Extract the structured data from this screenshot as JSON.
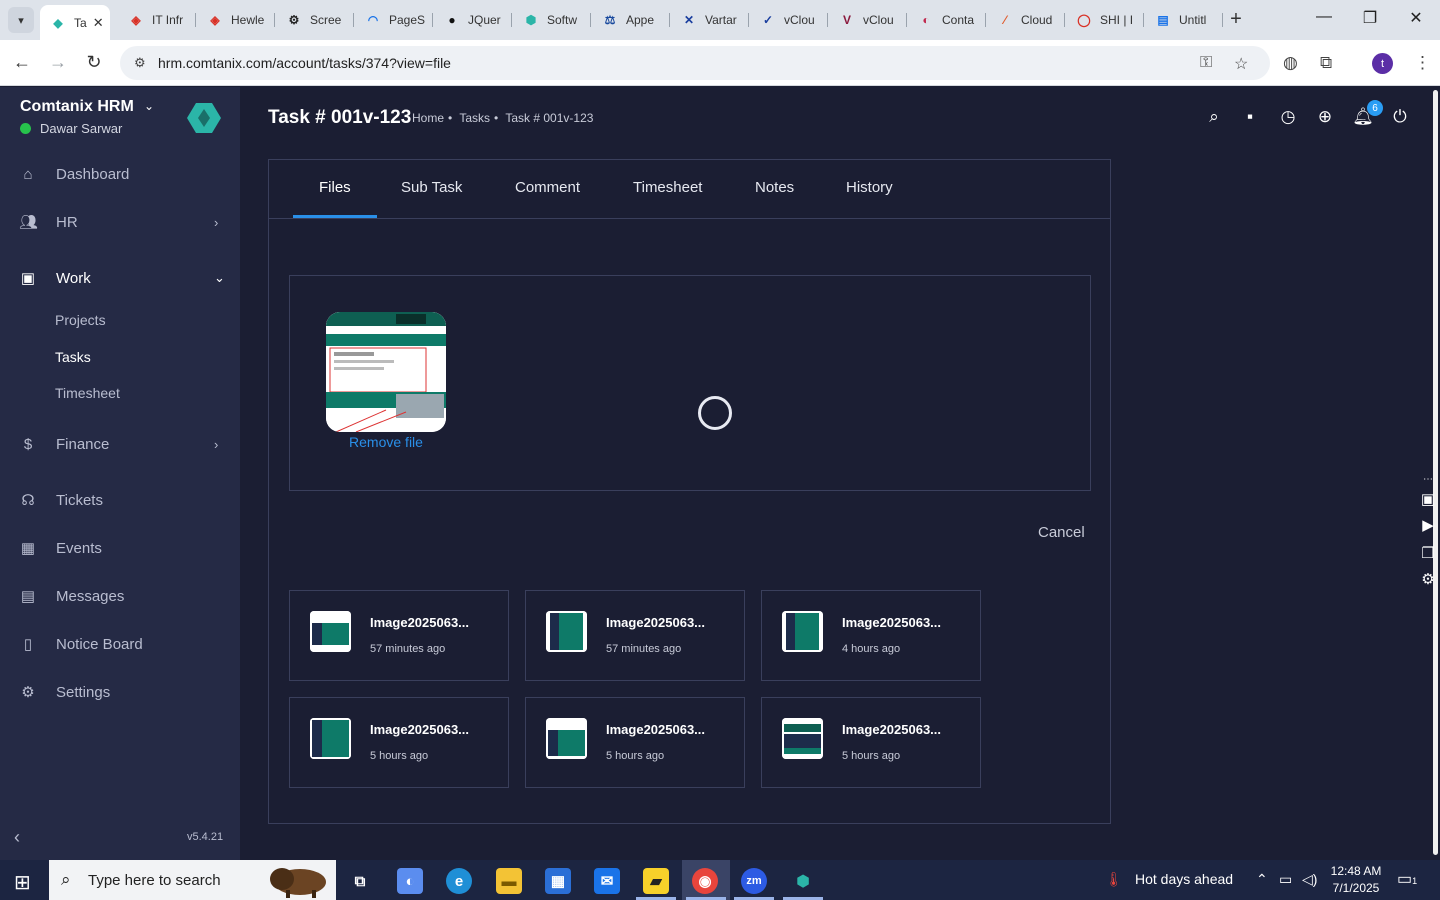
{
  "browser": {
    "tabs": [
      {
        "label": "Ta",
        "favicon": "hrm-logo-icon",
        "color": "#2bb5a8",
        "active": true
      },
      {
        "label": "IT Infr",
        "favicon": "tag-icon",
        "color": "#d93025"
      },
      {
        "label": "Hewle",
        "favicon": "tag-icon",
        "color": "#d93025"
      },
      {
        "label": "Scree",
        "favicon": "gear-icon",
        "color": "#222222"
      },
      {
        "label": "PageS",
        "favicon": "pagespeed-icon",
        "color": "#1a73e8"
      },
      {
        "label": "JQuer",
        "favicon": "github-icon",
        "color": "#111111"
      },
      {
        "label": "Softw",
        "favicon": "hex-icon",
        "color": "#2bb5a8"
      },
      {
        "label": "Appe",
        "favicon": "scale-icon",
        "color": "#1a4a9e"
      },
      {
        "label": "Vartar",
        "favicon": "x-icon",
        "color": "#1a3e9e"
      },
      {
        "label": "vClou",
        "favicon": "check-icon",
        "color": "#1a3e9e"
      },
      {
        "label": "vClou",
        "favicon": "v-icon",
        "color": "#8b1a3e"
      },
      {
        "label": "Conta",
        "favicon": "swirl-icon",
        "color": "#c0294e"
      },
      {
        "label": "Cloud",
        "favicon": "slash-icon",
        "color": "#e05a2b"
      },
      {
        "label": "SHI | I",
        "favicon": "ring-icon",
        "color": "#d93025"
      },
      {
        "label": "Untitl",
        "favicon": "doc-icon",
        "color": "#1a73e8"
      }
    ],
    "new_tab": "+",
    "url": "hrm.comtanix.com/account/tasks/374?view=file",
    "profile_initial": "t"
  },
  "sidebar": {
    "brand": "Comtanix HRM",
    "user": "Dawar Sarwar",
    "status_color": "#27c24c",
    "items": [
      {
        "label": "Dashboard",
        "icon": "home-icon"
      },
      {
        "label": "HR",
        "icon": "users-icon",
        "has_arrow": true
      },
      {
        "label": "Work",
        "icon": "briefcase-icon",
        "expanded": true
      },
      {
        "label": "Finance",
        "icon": "dollar-icon",
        "has_arrow": true
      },
      {
        "label": "Tickets",
        "icon": "headset-icon"
      },
      {
        "label": "Events",
        "icon": "calendar-icon"
      },
      {
        "label": "Messages",
        "icon": "message-icon"
      },
      {
        "label": "Notice Board",
        "icon": "clipboard-icon"
      },
      {
        "label": "Settings",
        "icon": "settings-icon"
      }
    ],
    "work_sub": [
      "Projects",
      "Tasks",
      "Timesheet"
    ],
    "active_sub": "Tasks",
    "version": "v5.4.21"
  },
  "header": {
    "title": "Task # 001v-123",
    "breadcrumb": [
      "Home",
      "Tasks",
      "Task # 001v-123"
    ],
    "notification_count": "6"
  },
  "task_tabs": [
    "Files",
    "Sub Task",
    "Comment",
    "Timesheet",
    "Notes",
    "History"
  ],
  "active_tab": "Files",
  "upload": {
    "remove_label": "Remove file",
    "cancel_label": "Cancel"
  },
  "files": [
    {
      "name": "Image2025063...",
      "time": "57 minutes ago"
    },
    {
      "name": "Image2025063...",
      "time": "57 minutes ago"
    },
    {
      "name": "Image2025063...",
      "time": "4 hours ago"
    },
    {
      "name": "Image2025063...",
      "time": "5 hours ago"
    },
    {
      "name": "Image2025063...",
      "time": "5 hours ago"
    },
    {
      "name": "Image2025063...",
      "time": "5 hours ago"
    }
  ],
  "taskbar": {
    "search_placeholder": "Type here to search",
    "weather": "Hot days ahead",
    "time": "12:48 AM",
    "date": "7/1/2025",
    "notifications": "1"
  },
  "colors": {
    "accent": "#2a8fe8",
    "sidebar_bg": "#252a45",
    "content_bg": "#1b1e33"
  }
}
